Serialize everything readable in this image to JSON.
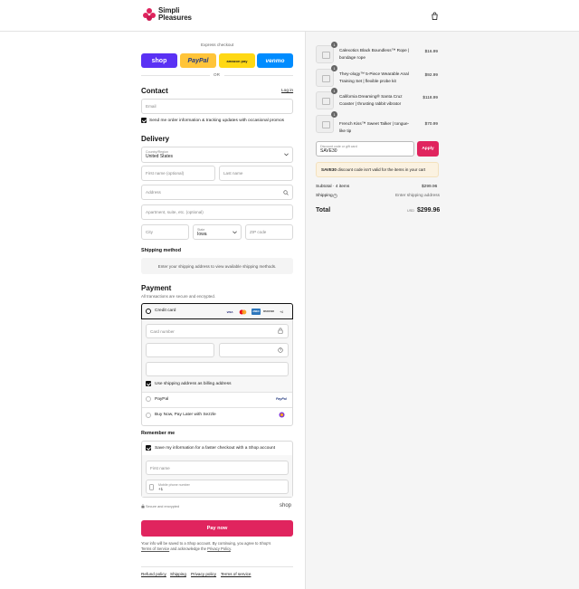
{
  "brand": {
    "name_line1": "Simpli",
    "name_line2": "Pleasures",
    "accent": "#e0245e"
  },
  "express": {
    "title": "Express checkout",
    "or": "OR",
    "buttons": [
      {
        "label": "shop",
        "color": "#5a31f4"
      },
      {
        "label": "PayPal",
        "color": "#ffc439"
      },
      {
        "label": "amazon pay",
        "color": "#ffd814"
      },
      {
        "label": "venmo",
        "color": "#008cff"
      }
    ]
  },
  "contact": {
    "title": "Contact",
    "login": "Log in",
    "email_placeholder": "Email",
    "news_label": "Send me order information & tracking updates with occasional promos"
  },
  "delivery": {
    "title": "Delivery",
    "country_label": "Country/Region",
    "country_value": "United States",
    "first_name": "First name (optional)",
    "last_name": "Last name",
    "address": "Address",
    "apartment": "Apartment, suite, etc. (optional)",
    "city": "City",
    "state_label": "State",
    "state_value": "Iowa",
    "zip": "ZIP code"
  },
  "shipping": {
    "title": "Shipping method",
    "message": "Enter your shipping address to view available shipping methods."
  },
  "payment": {
    "title": "Payment",
    "subtitle": "All transactions are secure and encrypted.",
    "credit_card": "Credit card",
    "card_number": "Card number",
    "expiry": "Expiration date (MM / YY)",
    "security": "Security code",
    "name_on_card": "Name on card",
    "billing_label": "Use shipping address as billing address",
    "paypal": "PayPal",
    "sezzle": "Buy Now, Pay Later with Sezzle",
    "more_cards": "+4"
  },
  "remember": {
    "title": "Remember me",
    "save_label": "Save my information for a faster checkout with a Shop account",
    "first_name": "First name",
    "phone_label": "Mobile phone number",
    "phone_value": "+1",
    "secure": "Secure and encrypted",
    "shop": "shop"
  },
  "pay_button": "Pay now",
  "legal": {
    "line1": "Your info will be saved to a Shop account. By continuing, you agree to Shop's",
    "tos": "Terms of Service",
    "mid": "and acknowledge the",
    "privacy": "Privacy Policy",
    "end": "."
  },
  "footer_links": [
    "Refund policy",
    "Shipping",
    "Privacy policy",
    "Terms of service"
  ],
  "cart": {
    "items": [
      {
        "qty": "1",
        "name": "Calexotics Black Boundless™ Rope | bondage rope",
        "price": "$16.99"
      },
      {
        "qty": "1",
        "name": "They-ology™ 5-Piece Wearable Anal Training Set | flexible probe kit",
        "price": "$92.99"
      },
      {
        "qty": "1",
        "name": "California Dreaming® Santa Cruz Coaster | thrusting rabbit vibrator",
        "price": "$118.99"
      },
      {
        "qty": "1",
        "name": "French Kiss™ Sweet Talker | tongue-like tip",
        "price": "$70.99"
      }
    ],
    "discount_label": "Discount code or gift card",
    "discount_value": "SAVE30",
    "apply": "Apply",
    "error_code": "SAVE30",
    "error_text": "discount code isn't valid for the items in your cart",
    "subtotal_label": "Subtotal · 4 items",
    "subtotal_value": "$299.96",
    "shipping_label": "Shipping",
    "shipping_value": "Enter shipping address",
    "total_label": "Total",
    "currency": "USD",
    "total_value": "$299.96"
  }
}
